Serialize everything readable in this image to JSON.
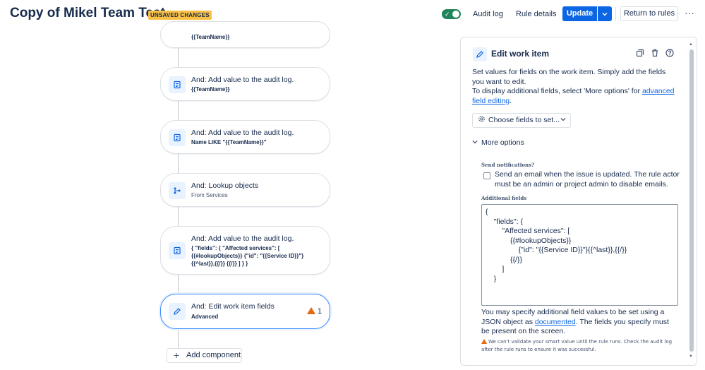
{
  "header": {
    "title": "Copy of Mikel Team Test",
    "badge": "UNSAVED CHANGES",
    "toggle_on": true,
    "audit_log": "Audit log",
    "rule_details": "Rule details",
    "update": "Update",
    "return": "Return to rules"
  },
  "canvas": {
    "cards": [
      {
        "sub": "{{TeamName}}"
      },
      {
        "title": "And: Add value to the audit log.",
        "sub": "{{TeamName}}"
      },
      {
        "title": "And: Add value to the audit log.",
        "sub": "Name LIKE \"{{TeamName}}\""
      },
      {
        "title": "And: Lookup objects",
        "sub": "From Services"
      },
      {
        "title": "And: Add value to the audit log.",
        "sub": "{ \"fields\": { \"Affected services\": [ {{#lookupObjects}} {\"id\": \"{{Service ID}}\"}{{^last}},{{/}} {{/}} ] } }"
      },
      {
        "title": "And: Edit work item fields",
        "sub": "Advanced",
        "warning_count": "1"
      }
    ],
    "add_component": "Add component"
  },
  "panel": {
    "title": "Edit work item",
    "desc_1": "Set values for fields on the work item. Simply add the fields you want to edit.",
    "desc_2": "To display additional fields, select 'More options' for ",
    "desc_link": "advanced field editing",
    "desc_end": ".",
    "choose_fields": "Choose fields to set...",
    "more_options": "More options",
    "send_notifications": "Send notifications?",
    "notify_text": "Send an email when the issue is updated. The rule actor must be an admin or project admin to disable emails.",
    "additional_fields": "Additional fields",
    "json_value": "{\n    \"fields\": {\n        \"Affected services\": [\n            {{#lookupObjects}}\n                {\"id\": \"{{Service ID}}\"}{{^last}},{{/}}\n            {{/}}\n        ]\n    }",
    "help_1": "You may specify additional field values to be set using a JSON object as ",
    "help_link": "documented",
    "help_2": ". The fields you specify must be present on the screen.",
    "validate_warning": "We can't validate your smart value until the rule runs. Check the audit log after the rule runs to ensure it was successful."
  },
  "colors": {
    "primary": "#0c66e4",
    "toggle": "#1f845a",
    "badge": "#f8c044",
    "warning": "#e56910"
  }
}
